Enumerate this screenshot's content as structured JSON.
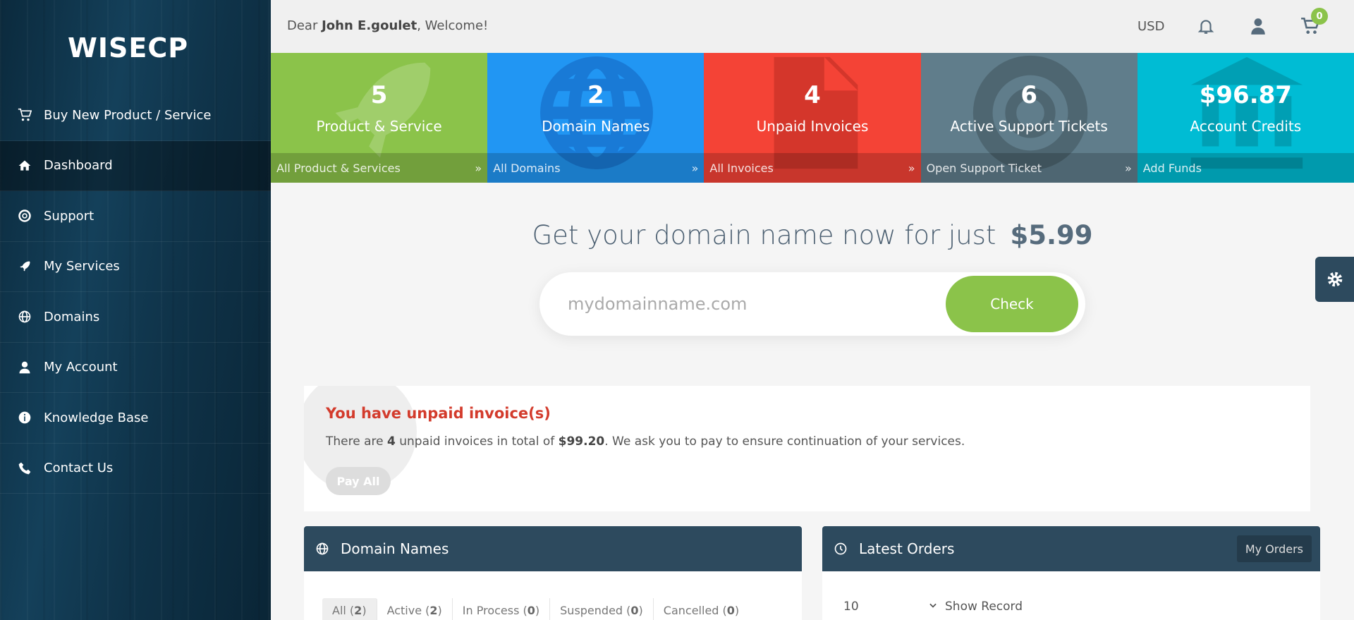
{
  "brand": {
    "logo_text": "WISECP"
  },
  "sidebar": {
    "items": [
      {
        "label": "Buy New Product / Service",
        "icon": "cart-icon"
      },
      {
        "label": "Dashboard",
        "icon": "home-icon",
        "active": true
      },
      {
        "label": "Support",
        "icon": "lifebuoy-icon"
      },
      {
        "label": "My Services",
        "icon": "rocket-icon"
      },
      {
        "label": "Domains",
        "icon": "globe-icon"
      },
      {
        "label": "My Account",
        "icon": "user-icon"
      },
      {
        "label": "Knowledge Base",
        "icon": "info-icon"
      },
      {
        "label": "Contact Us",
        "icon": "phone-icon"
      }
    ]
  },
  "header": {
    "greeting_prefix": "Dear ",
    "user_name": "John E.goulet",
    "greeting_suffix": ", Welcome!",
    "currency": "USD",
    "cart_count": "0"
  },
  "tiles": [
    {
      "value": "5",
      "label": "Product & Service",
      "link": "All Product & Services",
      "arrow": "»",
      "color": "#8bc34a",
      "icon": "rocket-icon"
    },
    {
      "value": "2",
      "label": "Domain Names",
      "link": "All Domains",
      "arrow": "»",
      "color": "#2196f3",
      "icon": "globe-icon"
    },
    {
      "value": "4",
      "label": "Unpaid Invoices",
      "link": "All Invoices",
      "arrow": "»",
      "color": "#f44336",
      "icon": "document-icon"
    },
    {
      "value": "6",
      "label": "Active Support Tickets",
      "link": "Open Support Ticket",
      "arrow": "»",
      "color": "#607d8b",
      "icon": "lifebuoy-icon"
    },
    {
      "value": "$96.87",
      "label": "Account Credits",
      "link": "Add Funds",
      "arrow": "",
      "color": "#00bcd4",
      "icon": "bank-icon"
    }
  ],
  "domain_search": {
    "headline": "Get your domain name now for just",
    "price": "$5.99",
    "placeholder": "mydomainname.com",
    "button": "Check"
  },
  "unpaid_notice": {
    "title": "You have unpaid invoice(s)",
    "text_1": "There are ",
    "count": "4",
    "text_2": " unpaid invoices in total of ",
    "total": "$99.20",
    "text_3": ". We ask you to pay to ensure continuation of your services.",
    "button": "Pay All"
  },
  "domain_panel": {
    "title": "Domain Names",
    "filters": [
      {
        "label": "All",
        "count": "2",
        "active": true
      },
      {
        "label": "Active",
        "count": "2"
      },
      {
        "label": "In Process",
        "count": "0"
      },
      {
        "label": "Suspended",
        "count": "0"
      },
      {
        "label": "Cancelled",
        "count": "0"
      }
    ]
  },
  "orders_panel": {
    "title": "Latest Orders",
    "button": "My Orders",
    "records_value": "10",
    "records_label": "Show Record"
  }
}
